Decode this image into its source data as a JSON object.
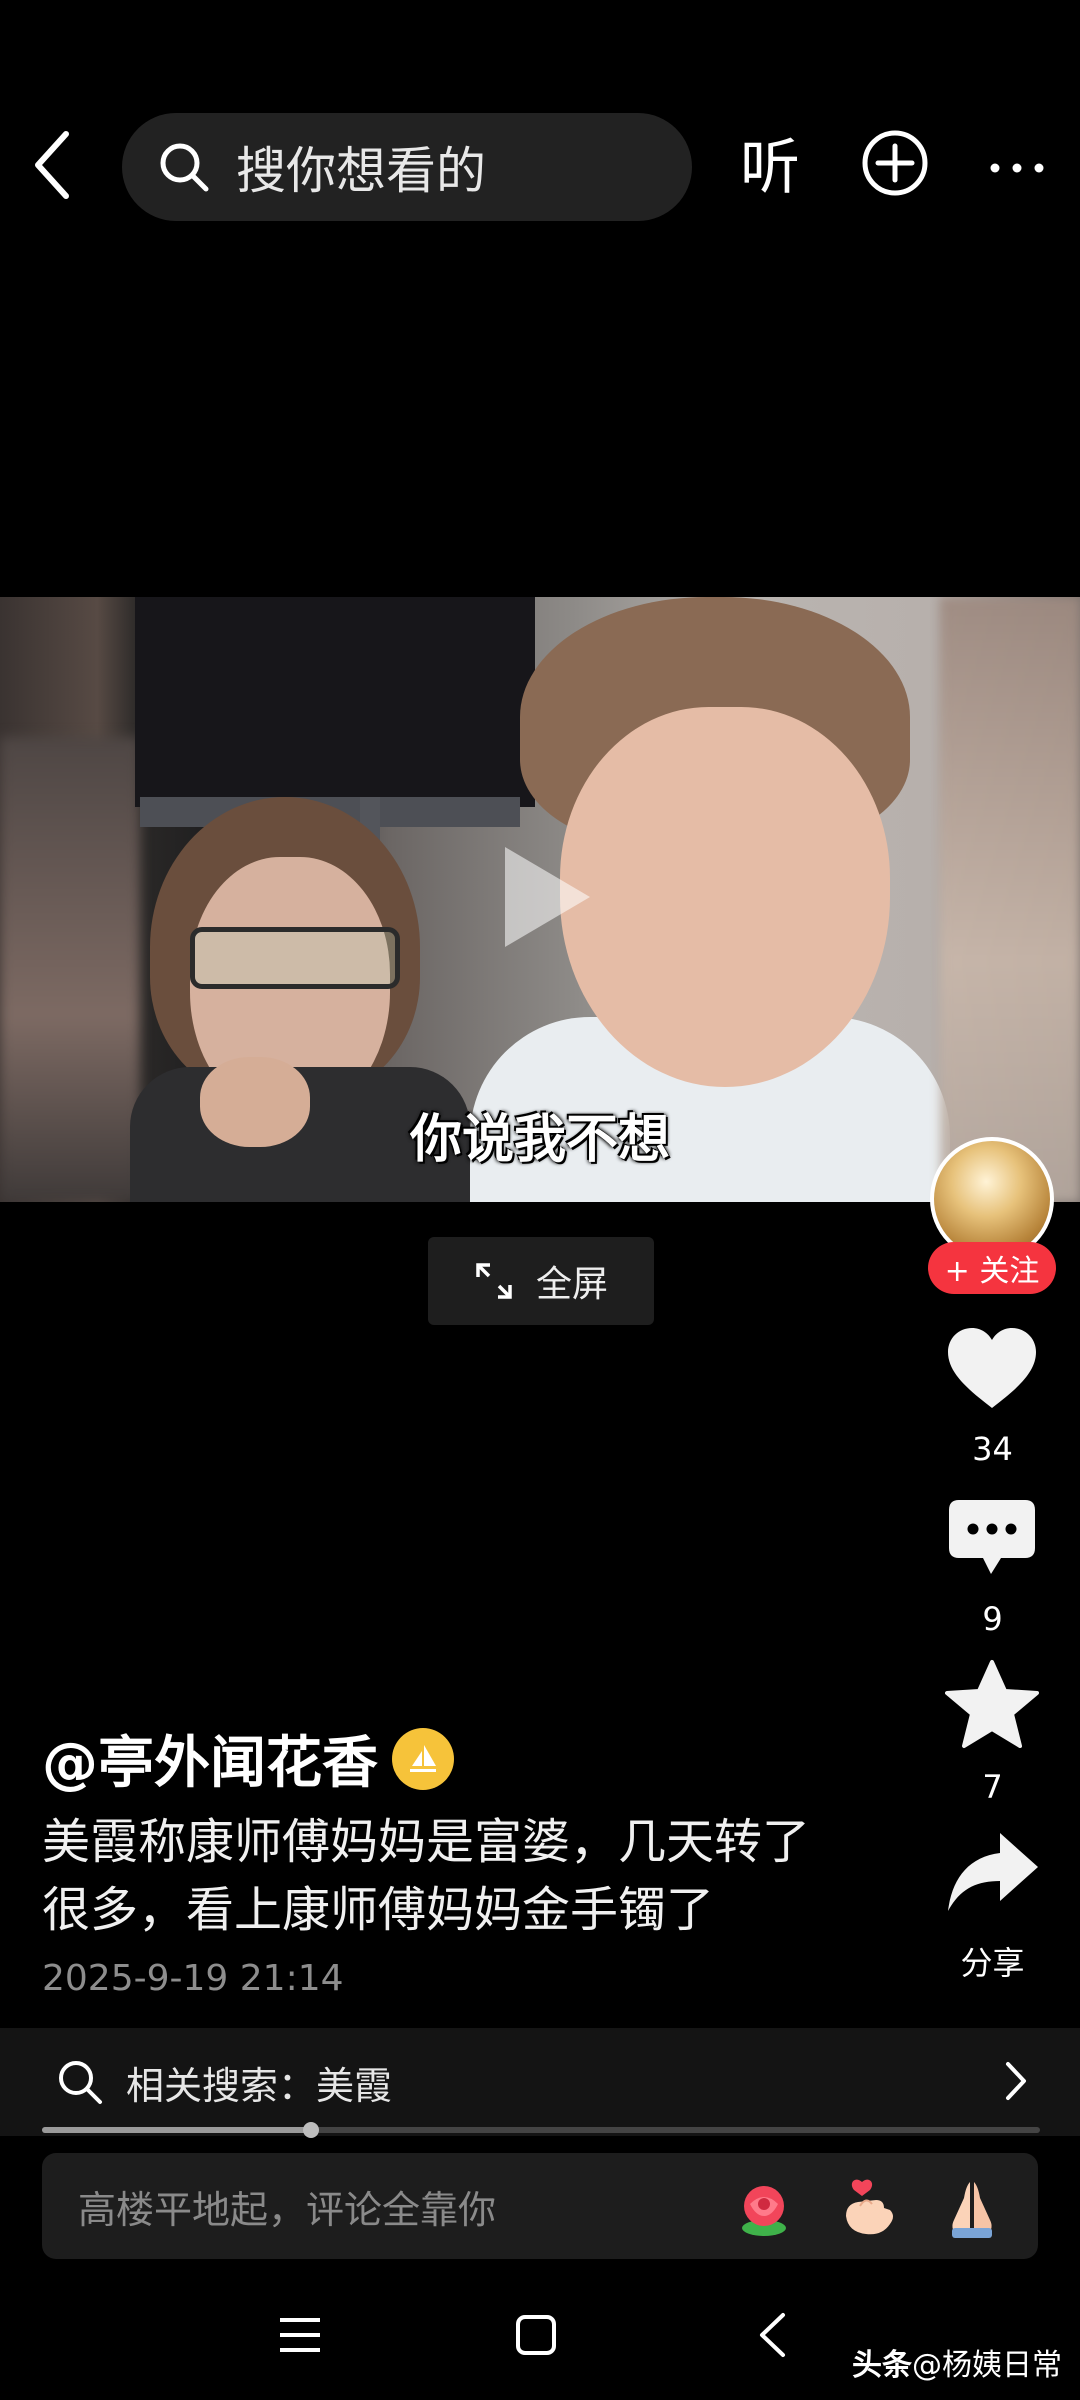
{
  "header": {
    "search_placeholder": "搜你想看的",
    "listen_label": "听"
  },
  "video": {
    "subtitle": "你说我不想",
    "fullscreen_label": "全屏"
  },
  "side_rail": {
    "follow_label": "+ 关注",
    "like_count": "34",
    "comment_count": "9",
    "favorite_count": "7",
    "share_label": "分享"
  },
  "post": {
    "author": "@亭外闻花香",
    "description_line1": "美霞称康师傅妈妈是富婆，几天转了",
    "description_line2": "很多，看上康师傅妈妈金手镯了",
    "date": "2025-9-19 21:14"
  },
  "related_search": {
    "label": "相关搜索：美霞"
  },
  "playback": {
    "progress": 0.27
  },
  "comment_bar": {
    "placeholder": "高楼平地起，评论全靠你"
  },
  "watermark": {
    "brand": "头条",
    "handle": "@杨姨日常"
  },
  "icons": {
    "back": "chevron-left-icon",
    "search": "search-icon",
    "add": "plus-circle-icon",
    "more": "more-icon",
    "play": "play-icon",
    "fullscreen": "expand-icon",
    "like": "heart-icon",
    "comment": "comment-icon",
    "favorite": "star-icon",
    "share": "share-icon"
  },
  "colors": {
    "background": "#000000",
    "follow": "#f5343f",
    "verified_badge": "#f6c33a"
  }
}
